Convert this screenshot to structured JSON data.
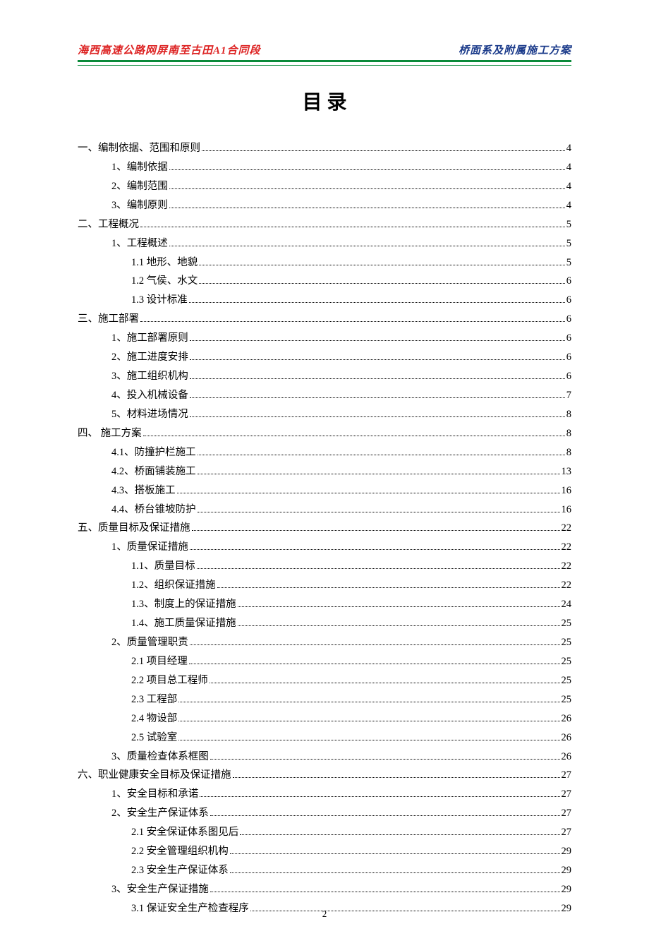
{
  "header": {
    "left": "海西高速公路网屏南至古田A1合同段",
    "right": "桥面系及附属施工方案"
  },
  "title": "目 录",
  "page_number": "2",
  "toc": [
    {
      "level": 0,
      "label": "一、编制依据、范围和原则",
      "page": "4"
    },
    {
      "level": 1,
      "label": "1、编制依据",
      "page": "4"
    },
    {
      "level": 1,
      "label": "2、编制范围",
      "page": "4"
    },
    {
      "level": 1,
      "label": "3、编制原则",
      "page": "4"
    },
    {
      "level": 0,
      "label": "二、工程概况",
      "page": "5"
    },
    {
      "level": 1,
      "label": "1、工程概述",
      "page": "5"
    },
    {
      "level": 2,
      "label": "1.1 地形、地貌",
      "page": "5"
    },
    {
      "level": 2,
      "label": "1.2 气侯、水文",
      "page": "6"
    },
    {
      "level": 2,
      "label": "1.3 设计标准",
      "page": "6"
    },
    {
      "level": 0,
      "label": "三、施工部署",
      "page": "6"
    },
    {
      "level": 1,
      "label": "1、施工部署原则",
      "page": "6"
    },
    {
      "level": 1,
      "label": "2、施工进度安排",
      "page": "6"
    },
    {
      "level": 1,
      "label": "3、施工组织机构",
      "page": "6"
    },
    {
      "level": 1,
      "label": "4、投入机械设备",
      "page": "7"
    },
    {
      "level": 1,
      "label": "5、材料进场情况",
      "page": "8"
    },
    {
      "level": 0,
      "label": "四、 施工方案",
      "page": "8"
    },
    {
      "level": 1,
      "label": "4.1、防撞护栏施工",
      "page": "8"
    },
    {
      "level": 1,
      "label": "4.2、桥面铺装施工",
      "page": "13"
    },
    {
      "level": 1,
      "label": "4.3、搭板施工",
      "page": "16"
    },
    {
      "level": 1,
      "label": "4.4、桥台锥坡防护",
      "page": "16"
    },
    {
      "level": 0,
      "label": "五、质量目标及保证措施",
      "page": "22"
    },
    {
      "level": 1,
      "label": "1、质量保证措施",
      "page": "22"
    },
    {
      "level": 2,
      "label": "1.1、质量目标",
      "page": "22"
    },
    {
      "level": 2,
      "label": "1.2、组织保证措施",
      "page": "22"
    },
    {
      "level": 2,
      "label": "1.3、制度上的保证措施",
      "page": "24"
    },
    {
      "level": 2,
      "label": "1.4、施工质量保证措施",
      "page": "25"
    },
    {
      "level": 1,
      "label": "2、质量管理职责",
      "page": "25"
    },
    {
      "level": 2,
      "label": "2.1 项目经理",
      "page": "25"
    },
    {
      "level": 2,
      "label": "2.2 项目总工程师",
      "page": "25"
    },
    {
      "level": 2,
      "label": "2.3 工程部",
      "page": "25"
    },
    {
      "level": 2,
      "label": "2.4 物设部",
      "page": "26"
    },
    {
      "level": 2,
      "label": "2.5 试验室",
      "page": "26"
    },
    {
      "level": 1,
      "label": "3、质量检查体系框图",
      "page": "26"
    },
    {
      "level": 0,
      "label": "六、职业健康安全目标及保证措施",
      "page": "27"
    },
    {
      "level": 1,
      "label": "1、安全目标和承诺",
      "page": "27"
    },
    {
      "level": 1,
      "label": "2、安全生产保证体系",
      "page": "27"
    },
    {
      "level": 2,
      "label": "2.1 安全保证体系图见后",
      "page": "27"
    },
    {
      "level": 2,
      "label": "2.2 安全管理组织机构",
      "page": "29"
    },
    {
      "level": 2,
      "label": "2.3 安全生产保证体系",
      "page": "29"
    },
    {
      "level": 1,
      "label": "3、安全生产保证措施",
      "page": "29"
    },
    {
      "level": 2,
      "label": "3.1 保证安全生产检查程序",
      "page": "29"
    }
  ]
}
